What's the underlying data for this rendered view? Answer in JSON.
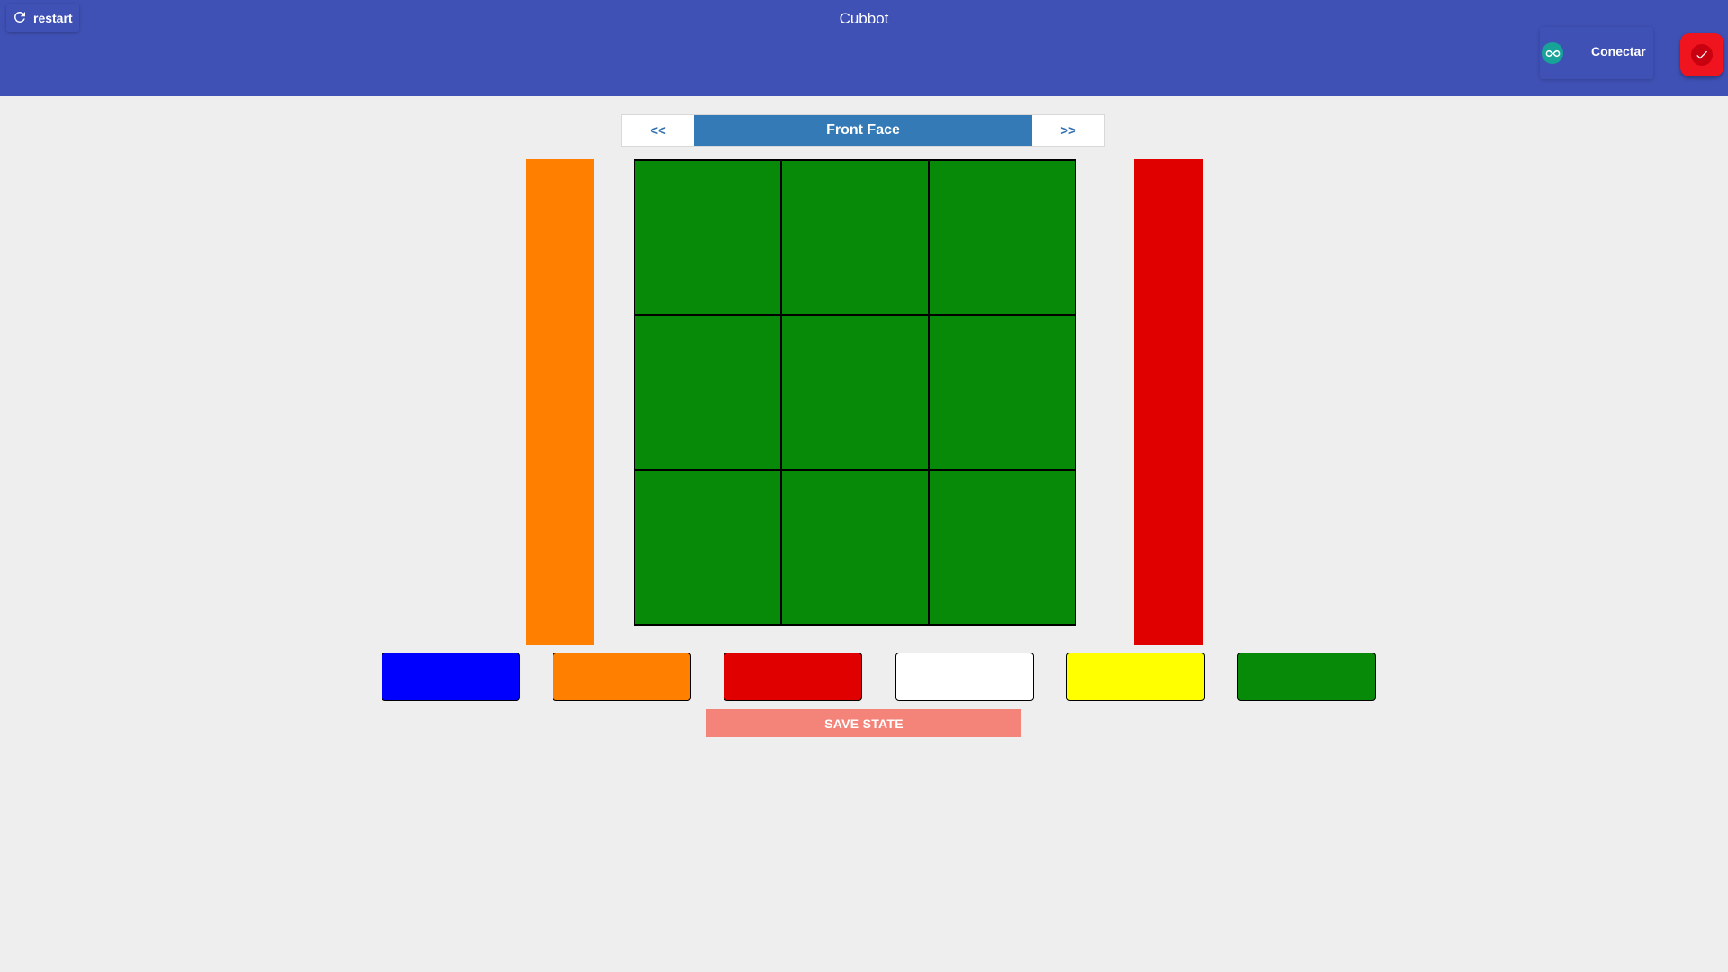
{
  "header": {
    "title": "Cubbot",
    "restart_label": "restart",
    "restart_icon": "refresh-icon",
    "connect_label": "Conectar",
    "connect_icon": "arduino-icon",
    "status_icon": "check-icon"
  },
  "face_nav": {
    "prev_label": "<<",
    "next_label": ">>",
    "face_title": "Front Face"
  },
  "colors": {
    "header_bg": "#3f51b5",
    "face_title_bg": "#337ab7",
    "blue": "#0000ff",
    "orange": "#ff7f00",
    "red": "#e00000",
    "white": "#ffffff",
    "yellow": "#ffff00",
    "green": "#068a07",
    "save_button": "#f4847a"
  },
  "cube": {
    "left_neighbor_color": "#ff7f00",
    "right_neighbor_color": "#e00000",
    "stickers": [
      "#068a07",
      "#068a07",
      "#068a07",
      "#068a07",
      "#068a07",
      "#068a07",
      "#068a07",
      "#068a07",
      "#068a07"
    ]
  },
  "palette": [
    {
      "name": "blue",
      "color": "#0000ff"
    },
    {
      "name": "orange",
      "color": "#ff7f00"
    },
    {
      "name": "red",
      "color": "#e00000"
    },
    {
      "name": "white",
      "color": "#ffffff"
    },
    {
      "name": "yellow",
      "color": "#ffff00"
    },
    {
      "name": "green",
      "color": "#068a07"
    }
  ],
  "save_label": "SAVE STATE"
}
